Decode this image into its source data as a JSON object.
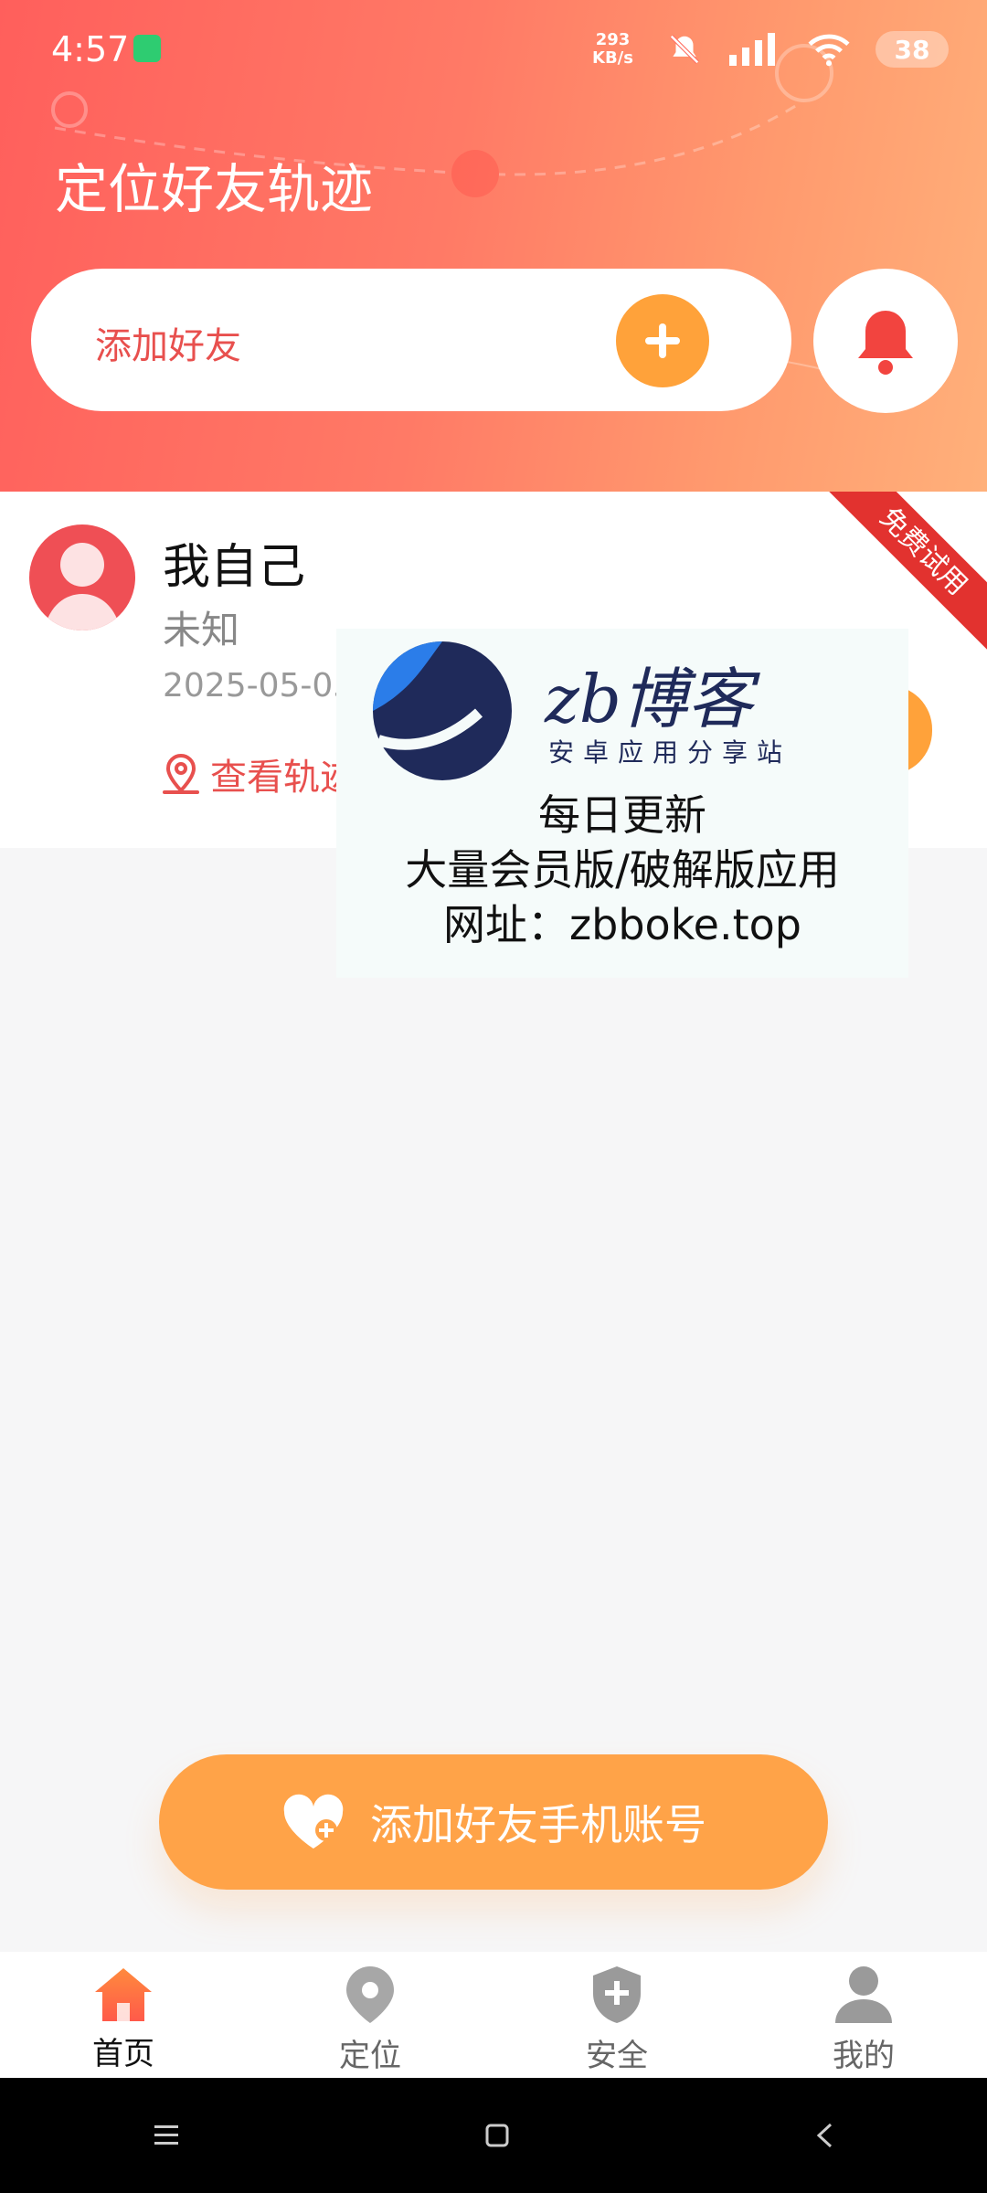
{
  "status_bar": {
    "time": "4:57",
    "speed_value": "293",
    "speed_unit": "KB/s",
    "battery": "38"
  },
  "header": {
    "title": "定位好友轨迹",
    "add_friend_label": "添加好友"
  },
  "friend_card": {
    "ribbon": "免费试用",
    "name": "我自己",
    "status": "未知",
    "date": "2025-05-05",
    "track_label": "查看轨迹"
  },
  "watermark": {
    "brand": "zb博客",
    "subtitle": "安卓应用分享站",
    "line1": "每日更新",
    "line2": "大量会员版/破解版应用",
    "line3": "网址：zbboke.top"
  },
  "cta": {
    "label": "添加好友手机账号"
  },
  "bottom_nav": {
    "items": [
      {
        "label": "首页",
        "icon": "home-icon",
        "active": true
      },
      {
        "label": "定位",
        "icon": "location-pin-icon",
        "active": false
      },
      {
        "label": "安全",
        "icon": "shield-icon",
        "active": false
      },
      {
        "label": "我的",
        "icon": "person-icon",
        "active": false
      }
    ]
  },
  "colors": {
    "accent_orange": "#ffa23a",
    "accent_red": "#e8504e",
    "header_start": "#ff5f5c",
    "header_end": "#ffb07a"
  }
}
